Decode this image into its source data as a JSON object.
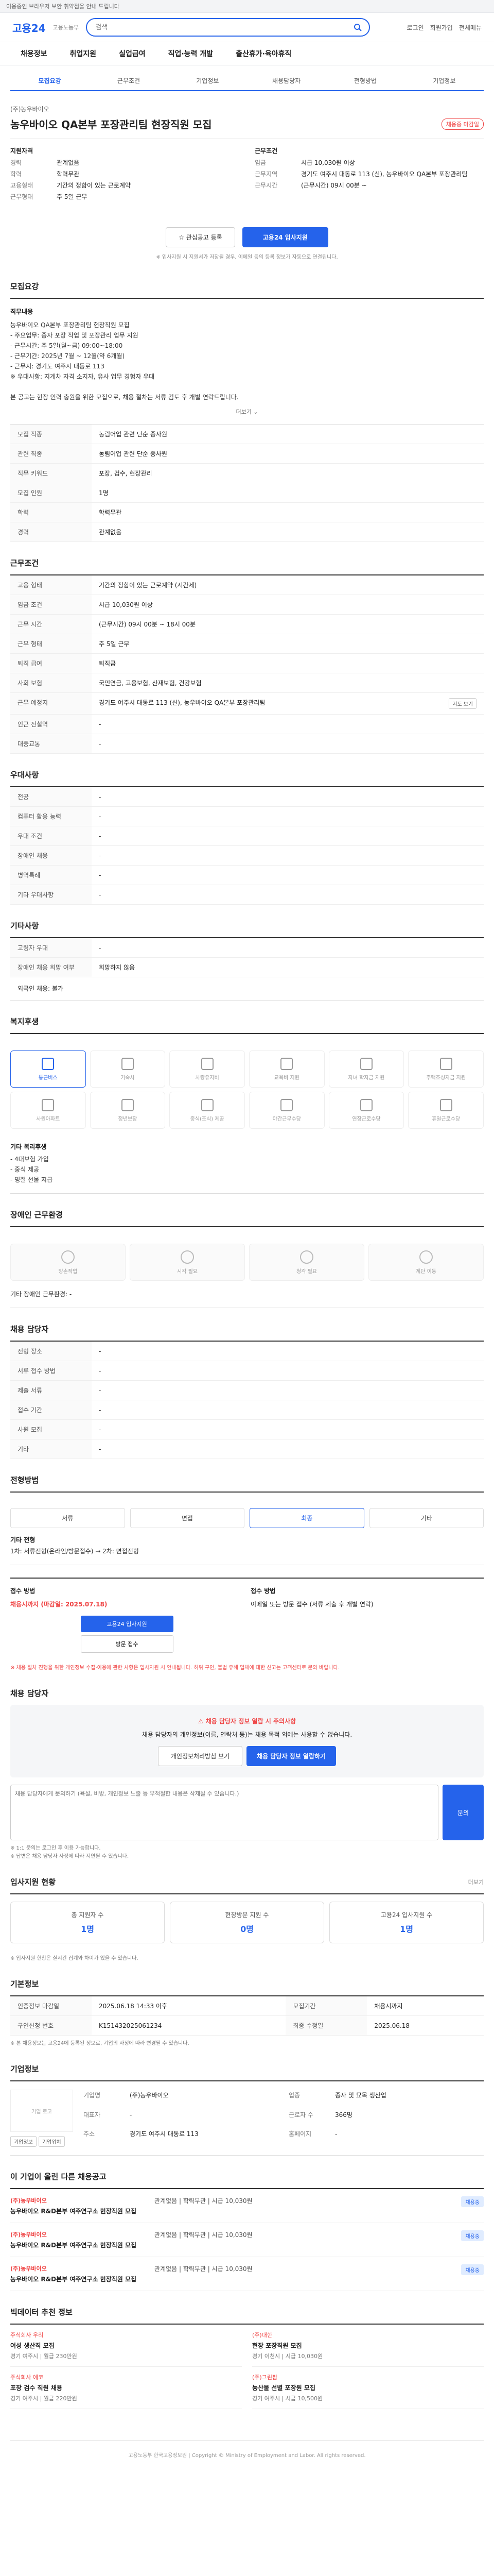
{
  "topbar": {
    "text": "이용중인 브라우저 보안 취약점을 안내 드립니다"
  },
  "header": {
    "logo": "고용24",
    "logo_sub": "고용노동부",
    "search_placeholder": "검색",
    "links": [
      "로그인",
      "회원가입",
      "전체메뉴"
    ]
  },
  "gnb": [
    "채용정보",
    "취업지원",
    "실업급여",
    "직업·능력 개발",
    "출산휴가·육아휴직"
  ],
  "detail_tabs": [
    "모집요강",
    "근무조건",
    "기업정보",
    "채용담당자",
    "전형방법",
    "기업정보"
  ],
  "job": {
    "company": "(주)농우바이오",
    "title": "농우바이오 QA본부 포장관리팀 현장직원 모집",
    "badge": "채용중 마감일",
    "left_title": "지원자격",
    "left": [
      {
        "k": "경력",
        "v": "관계없음"
      },
      {
        "k": "학력",
        "v": "학력무관"
      },
      {
        "k": "고용형태",
        "v": "기간의 정함이 있는 근로계약"
      },
      {
        "k": "근무형태",
        "v": "주 5일 근무"
      }
    ],
    "right_title": "근무조건",
    "right": [
      {
        "k": "임금",
        "v": "시급 10,030원 이상"
      },
      {
        "k": "근무지역",
        "v": "경기도 여주시 대동로 113 (신), 농우바이오 QA본부 포장관리팀"
      },
      {
        "k": "근무시간",
        "v": "(근무시간) 09시 00분 ~"
      }
    ]
  },
  "actions": {
    "scrap": "관심공고 등록",
    "apply": "고용24 입사지원",
    "notice": "※ 입사지원 시 지원서가 저장될 경우, 이메일 등의 등록 정보가 자동으로 연결됩니다."
  },
  "recruit": {
    "title": "모집요강",
    "body_title": "직무내용",
    "body": "농우바이오 QA본부 포장관리팀 현장직원 모집\n- 주요업무: 종자 포장 작업 및 포장관리 업무 지원\n- 근무시간: 주 5일(월~금) 09:00~18:00\n- 근무기간: 2025년 7월 ~ 12월(약 6개월)\n- 근무지: 경기도 여주시 대동로 113\n※ 우대사항: 지게차 자격 소지자, 유사 업무 경험자 우대\n\n본 공고는 현장 인력 충원을 위한 모집으로, 채용 절차는 서류 검토 후 개별 연락드립니다.",
    "more": "더보기",
    "rows": [
      {
        "k": "모집 직종",
        "v": "농림어업 관련 단순 종사원"
      },
      {
        "k": "관련 직종",
        "v": "농림어업 관련 단순 종사원"
      },
      {
        "k": "직무 키워드",
        "v": "포장, 검수, 현장관리"
      },
      {
        "k": "모집 인원",
        "v": "1명"
      },
      {
        "k": "학력",
        "v": "학력무관"
      },
      {
        "k": "경력",
        "v": "관계없음"
      }
    ]
  },
  "condition": {
    "title": "근무조건",
    "rows": [
      {
        "k": "고용 형태",
        "v": "기간의 정함이 있는 근로계약 (시간제)"
      },
      {
        "k": "임금 조건",
        "v": "시급 10,030원 이상"
      },
      {
        "k": "근무 시간",
        "v": "(근무시간) 09시 00분 ~ 18시 00분"
      },
      {
        "k": "근무 형태",
        "v": "주 5일 근무"
      },
      {
        "k": "퇴직 급여",
        "v": "퇴직금"
      },
      {
        "k": "사회 보험",
        "v": "국민연금, 고용보험, 산재보험, 건강보험"
      },
      {
        "k": "근무 예정지",
        "v": "경기도 여주시 대동로 113 (신), 농우바이오 QA본부 포장관리팀"
      },
      {
        "k": "인근 전철역",
        "v": "-"
      },
      {
        "k": "대중교통",
        "v": "-"
      }
    ],
    "map_btn": "지도 보기"
  },
  "prefer": {
    "title": "우대사항",
    "rows": [
      {
        "k": "전공",
        "v": "-"
      },
      {
        "k": "컴퓨터 활용 능력",
        "v": "-"
      },
      {
        "k": "우대 조건",
        "v": "-"
      },
      {
        "k": "장애인 채용",
        "v": "-"
      },
      {
        "k": "병역특례",
        "v": "-"
      },
      {
        "k": "기타 우대사항",
        "v": "-"
      }
    ]
  },
  "other": {
    "title": "기타사항",
    "rows": [
      {
        "k": "고령자 우대",
        "v": "-"
      },
      {
        "k": "장애인 채용 희망 여부",
        "v": "희망하지 않음"
      }
    ],
    "extra": "외국인 채용: 불가"
  },
  "welfare": {
    "title": "복지후생",
    "items": [
      {
        "label": "통근버스",
        "on": true
      },
      {
        "label": "기숙사",
        "on": false
      },
      {
        "label": "차량유지비",
        "on": false
      },
      {
        "label": "교육비 지원",
        "on": false
      },
      {
        "label": "자녀 학자금 지원",
        "on": false
      },
      {
        "label": "주택조성자금 지원",
        "on": false
      },
      {
        "label": "사원아파트",
        "on": false
      },
      {
        "label": "정년보장",
        "on": false
      },
      {
        "label": "중식(조식) 제공",
        "on": false
      },
      {
        "label": "야간근무수당",
        "on": false
      },
      {
        "label": "연장근로수당",
        "on": false
      },
      {
        "label": "휴일근로수당",
        "on": false
      }
    ],
    "extra_title": "기타 복리후생",
    "extra": "- 4대보험 가입\n- 중식 제공\n- 명절 선물 지급"
  },
  "disabled_env": {
    "title": "장애인 근무환경",
    "items": [
      "양손작업",
      "시각 필요",
      "청각 필요",
      "계단 이동"
    ],
    "extra": "기타 장애인 근무환경: -"
  },
  "hr_info": {
    "title": "채용 담당자",
    "rows": [
      {
        "k": "전형 장소",
        "v": "-"
      },
      {
        "k": "서류 접수 방법",
        "v": "-"
      },
      {
        "k": "제출 서류",
        "v": "-"
      },
      {
        "k": "접수 기간",
        "v": "-"
      },
      {
        "k": "사원 모집",
        "v": "-"
      },
      {
        "k": "기타",
        "v": "-"
      }
    ]
  },
  "process": {
    "title": "전형방법",
    "steps": [
      "서류",
      "면접",
      "최종",
      "기타"
    ],
    "text": "기타 전형",
    "desc": "1차: 서류전형(온라인/방문접수) → 2차: 면접전형"
  },
  "apply": {
    "col1_title": "접수 방법",
    "col1_red": "채용시까지 (마감일: 2025.07.18)",
    "apply_btn": "고용24 입사지원",
    "visit_btn": "방문 접수",
    "col2_title": "접수 방법",
    "col2": "이메일 또는 방문 접수 (서류 제출 후 개별 연락)",
    "warn": "※ 채용 절차 진행을 위한 개인정보 수집·이용에 관한 사항은 입사지원 시 안내됩니다. 허위 구인, 불법 유해 업체에 대한 신고는 고객센터로 문의 바랍니다."
  },
  "contact": {
    "title": "채용 담당자",
    "alert": "채용 담당자 정보 열람 시 주의사항",
    "desc": "채용 담당자의 개인정보(이름, 연락처 등)는 채용 목적 외에는 사용할 수 없습니다.",
    "btn1": "개인정보처리방침 보기",
    "btn2": "채용 담당자 정보 열람하기",
    "q_placeholder": "채용 담당자에게 문의하기 (욕설, 비방, 개인정보 노출 등 부적절한 내용은 삭제될 수 있습니다.)",
    "q_btn": "문의",
    "notes": "※ 1:1 문의는 로그인 후 이용 가능합니다.\n※ 답변은 채용 담당자 사정에 따라 지연될 수 있습니다."
  },
  "status": {
    "title": "입사지원 현황",
    "more": "더보기",
    "cards": [
      {
        "label": "총 지원자 수",
        "num": "1명"
      },
      {
        "label": "현장방문 지원 수",
        "num": "0명"
      },
      {
        "label": "고용24 입사지원 수",
        "num": "1명"
      }
    ],
    "note": "※ 입사지원 현황은 실시간 집계와 차이가 있을 수 있습니다."
  },
  "basic": {
    "title": "기본정보",
    "rows": [
      {
        "k": "인증정보 마감일",
        "v": "2025.06.18 14:33 이후"
      },
      {
        "k": "모집기간",
        "v": "채용시까지"
      },
      {
        "k": "구인신청 번호",
        "v": "K151432025061234"
      },
      {
        "k": "최종 수정일",
        "v": "2025.06.18"
      }
    ],
    "notes": "※ 본 채용정보는 고용24에 등록된 정보로, 기업의 사정에 따라 변경될 수 있습니다."
  },
  "agency": {
    "title": "기업정보",
    "logo_text": "기업 로고",
    "rows": [
      {
        "k": "기업명",
        "v": "(주)농우바이오"
      },
      {
        "k": "업종",
        "v": "종자 및 묘목 생산업"
      },
      {
        "k": "대표자",
        "v": "-"
      },
      {
        "k": "근로자 수",
        "v": "366명"
      },
      {
        "k": "주소",
        "v": "경기도 여주시 대동로 113"
      },
      {
        "k": "홈페이지",
        "v": "-"
      }
    ],
    "btn1": "기업정보",
    "btn2": "기업위치"
  },
  "similar": {
    "title": "이 기업이 올린 다른 채용공고",
    "items": [
      {
        "co": "(주)농우바이오",
        "ti": "농우바이오 R&D본부 여주연구소 현장직원 모집",
        "meta": "관계없음 | 학력무관 | 시급 10,030원",
        "tag": "채용중"
      },
      {
        "co": "(주)농우바이오",
        "ti": "농우바이오 R&D본부 여주연구소 현장직원 모집",
        "meta": "관계없음 | 학력무관 | 시급 10,030원",
        "tag": "채용중"
      },
      {
        "co": "(주)농우바이오",
        "ti": "농우바이오 R&D본부 여주연구소 현장직원 모집",
        "meta": "관계없음 | 학력무관 | 시급 10,030원",
        "tag": "채용중"
      }
    ]
  },
  "recommend": {
    "title": "빅데이터 추천 정보",
    "items": [
      {
        "co": "주식회사 우리",
        "ti": "여성 생산직 모집",
        "meta": "경기 여주시 | 월급 230만원"
      },
      {
        "co": "(주)대한",
        "ti": "현장 포장직원 모집",
        "meta": "경기 이천시 | 시급 10,030원"
      },
      {
        "co": "주식회사 에코",
        "ti": "포장 검수 직원 채용",
        "meta": "경기 여주시 | 월급 220만원"
      },
      {
        "co": "(주)그린팜",
        "ti": "농산물 선별 포장원 모집",
        "meta": "경기 여주시 | 시급 10,500원"
      }
    ]
  },
  "footer": {
    "text": "고용노동부 한국고용정보원 | Copyright © Ministry of Employment and Labor. All rights reserved."
  },
  "colors": {
    "primary": "#2563eb",
    "alert": "#ef4444"
  }
}
